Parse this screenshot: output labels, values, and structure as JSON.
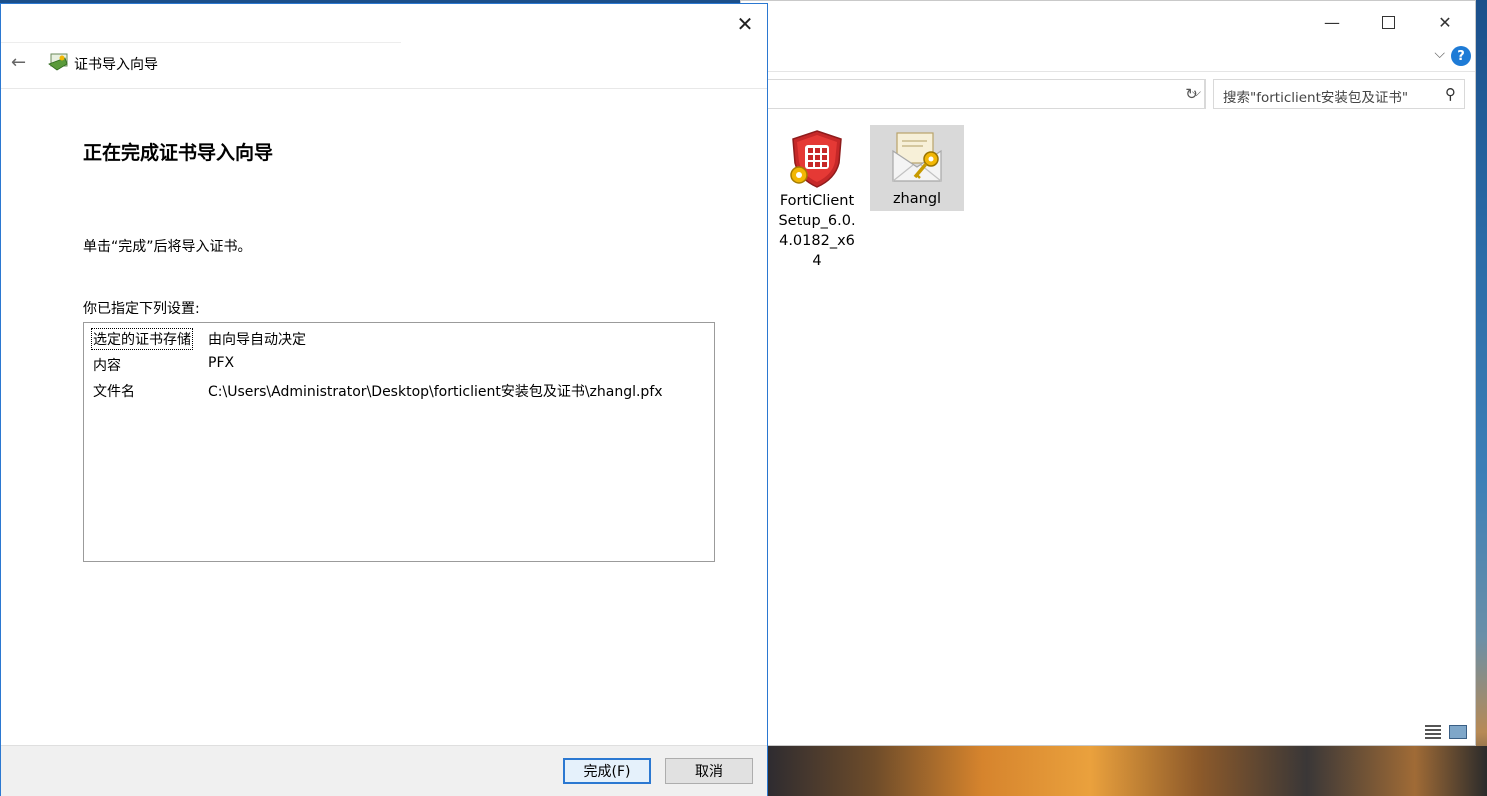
{
  "wizard": {
    "title": "证书导入向导",
    "heading": "正在完成证书导入向导",
    "instruction": "单击“完成”后将导入证书。",
    "settings_label": "你已指定下列设置:",
    "settings": [
      {
        "key": "选定的证书存储",
        "value": "由向导自动决定"
      },
      {
        "key": "内容",
        "value": "PFX"
      },
      {
        "key": "文件名",
        "value": "C:\\Users\\Administrator\\Desktop\\forticlient安装包及证书\\zhangl.pfx"
      }
    ],
    "finish_label": "完成(F)",
    "cancel_label": "取消",
    "close_glyph": "✕",
    "back_glyph": "←"
  },
  "explorer": {
    "search_placeholder": "搜索\"forticlient安装包及证书\"",
    "help_glyph": "?",
    "files": [
      {
        "name_lines": [
          "FortiClient",
          "Setup_6.0.",
          "4.0182_x6",
          "4"
        ],
        "icon": "forticlient-shield-icon"
      },
      {
        "name_lines": [
          "zhangl"
        ],
        "icon": "certificate-key-icon"
      }
    ]
  },
  "colors": {
    "accent": "#2b78d1",
    "selection": "#d9d9d9",
    "footer_bg": "#f0f0f0"
  }
}
